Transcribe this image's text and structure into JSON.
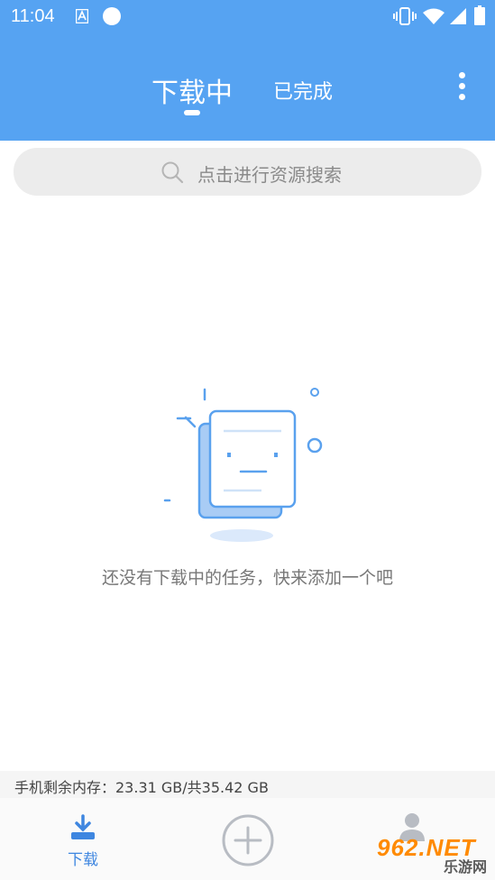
{
  "status_bar": {
    "time": "11:04"
  },
  "header": {
    "tabs": [
      {
        "label": "下载中",
        "active": true
      },
      {
        "label": "已完成",
        "active": false
      }
    ],
    "accent_color": "#56a3f2"
  },
  "search": {
    "placeholder": "点击进行资源搜索"
  },
  "empty_state": {
    "message": "还没有下载中的任务，快来添加一个吧"
  },
  "storage": {
    "text": "手机剩余内存：23.31 GB/共35.42 GB"
  },
  "bottom_nav": {
    "download_label": "下载",
    "download_icon": "download-icon",
    "add_icon": "plus-circle-icon",
    "profile_icon": "avatar-icon"
  },
  "watermark": {
    "logo": "962.NET",
    "site_label": "乐游网"
  }
}
